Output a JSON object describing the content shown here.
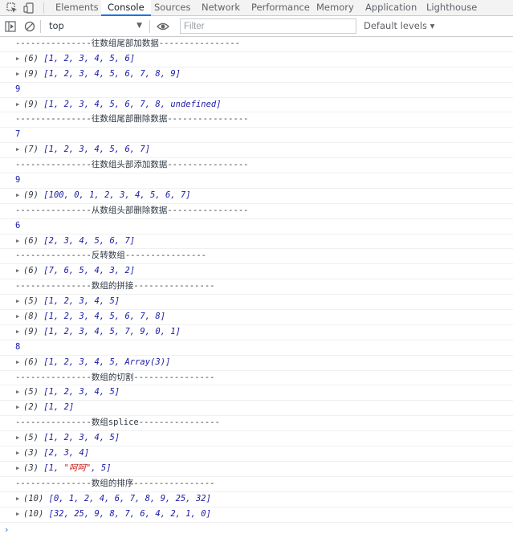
{
  "tabs": [
    "Elements",
    "Console",
    "Sources",
    "Network",
    "Performance",
    "Memory",
    "Application",
    "Lighthouse"
  ],
  "active_tab": "Console",
  "toolbar": {
    "context": "top",
    "filter_placeholder": "Filter",
    "levels": "Default levels ▾"
  },
  "console_rows": [
    {
      "kind": "log",
      "text": "---------------往数组尾部加数据----------------"
    },
    {
      "kind": "arr",
      "count": "(6)",
      "body": "[1, 2, 3, 4, 5, 6]"
    },
    {
      "kind": "arr",
      "count": "(9)",
      "body": "[1, 2, 3, 4, 5, 6, 7, 8, 9]"
    },
    {
      "kind": "num",
      "text": "9"
    },
    {
      "kind": "arr",
      "count": "(9)",
      "body": "[1, 2, 3, 4, 5, 6, 7, 8, undefined]"
    },
    {
      "kind": "log",
      "text": "---------------往数组尾部删除数据----------------"
    },
    {
      "kind": "num",
      "text": "7"
    },
    {
      "kind": "arr",
      "count": "(7)",
      "body": "[1, 2, 3, 4, 5, 6, 7]"
    },
    {
      "kind": "log",
      "text": "---------------往数组头部添加数据----------------"
    },
    {
      "kind": "num",
      "text": "9"
    },
    {
      "kind": "arr",
      "count": "(9)",
      "body": "[100, 0, 1, 2, 3, 4, 5, 6, 7]"
    },
    {
      "kind": "log",
      "text": "---------------从数组头部删除数据----------------"
    },
    {
      "kind": "num",
      "text": "6"
    },
    {
      "kind": "arr",
      "count": "(6)",
      "body": "[2, 3, 4, 5, 6, 7]"
    },
    {
      "kind": "log",
      "text": "---------------反转数组----------------"
    },
    {
      "kind": "arr",
      "count": "(6)",
      "body": "[7, 6, 5, 4, 3, 2]"
    },
    {
      "kind": "log",
      "text": "---------------数组的拼接----------------"
    },
    {
      "kind": "arr",
      "count": "(5)",
      "body": "[1, 2, 3, 4, 5]"
    },
    {
      "kind": "arr",
      "count": "(8)",
      "body": "[1, 2, 3, 4, 5, 6, 7, 8]"
    },
    {
      "kind": "arr",
      "count": "(9)",
      "body": "[1, 2, 3, 4, 5, 7, 9, 0, 1]"
    },
    {
      "kind": "num",
      "text": "8"
    },
    {
      "kind": "arr",
      "count": "(6)",
      "body": "[1, 2, 3, 4, 5, Array(3)]"
    },
    {
      "kind": "log",
      "text": "---------------数组的切割----------------"
    },
    {
      "kind": "arr",
      "count": "(5)",
      "body": "[1, 2, 3, 4, 5]"
    },
    {
      "kind": "arr",
      "count": "(2)",
      "body": "[1, 2]"
    },
    {
      "kind": "log",
      "text": "---------------数组splice----------------"
    },
    {
      "kind": "arr",
      "count": "(5)",
      "body": "[1, 2, 3, 4, 5]"
    },
    {
      "kind": "arr",
      "count": "(3)",
      "body": "[2, 3, 4]"
    },
    {
      "kind": "arr",
      "count": "(3)",
      "body_pre": "[1, ",
      "body_str": "\"呵呵\"",
      "body_post": ", 5]"
    },
    {
      "kind": "log",
      "text": "---------------数组的排序----------------"
    },
    {
      "kind": "arr",
      "count": "(10)",
      "body": "[0, 1, 2, 4, 6, 7, 8, 9, 25, 32]"
    },
    {
      "kind": "arr",
      "count": "(10)",
      "body": "[32, 25, 9, 8, 7, 6, 4, 2, 1, 0]"
    }
  ],
  "icons": {
    "inspect": "inspect-element-icon",
    "device": "device-toolbar-icon",
    "sidebar": "show-sidebar-icon",
    "clear": "clear-console-icon",
    "eye": "live-expression-icon",
    "prompt": "console-prompt-icon"
  }
}
